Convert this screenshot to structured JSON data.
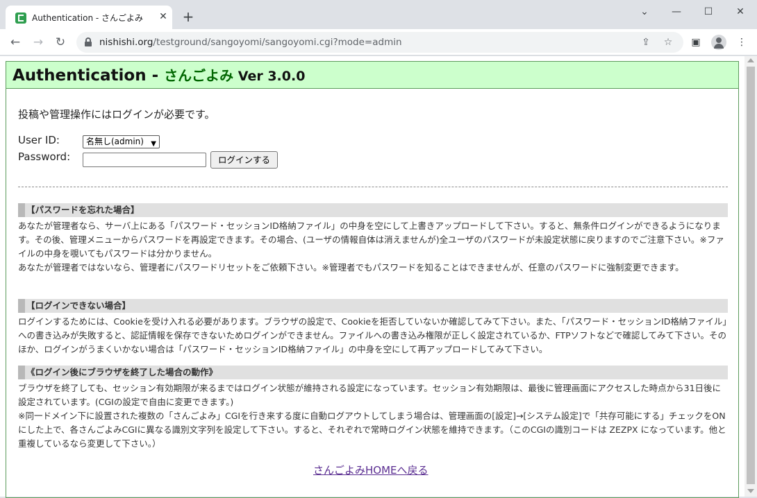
{
  "browser": {
    "tab_title": "Authentication - さんごよみ",
    "url_host": "nishishi.org",
    "url_path": "/testground/sangoyomi/sangoyomi.cgi?mode=admin",
    "close_glyph": "✕",
    "newtab_glyph": "+",
    "back_glyph": "←",
    "forward_glyph": "→",
    "reload_glyph": "↻",
    "minimize_glyph": "—",
    "maximize_glyph": "☐",
    "winclose_glyph": "✕",
    "dropdown_glyph": "⌄",
    "share_glyph": "⇪",
    "star_glyph": "☆",
    "sidepanel_glyph": "▣",
    "menu_glyph": "⋮"
  },
  "page": {
    "title_main": "Authentication - ",
    "title_app": "さんごよみ",
    "title_ver": " Ver 3.0.0",
    "intro": "投稿や管理操作にはログインが必要です。",
    "userid_label": "User ID:",
    "password_label": "Password:",
    "userid_value": "名無し(admin)",
    "login_button": "ログインする",
    "sections": [
      {
        "heading": "【パスワードを忘れた場合】",
        "body": "あなたが管理者なら、サーバ上にある「パスワード・セッションID格納ファイル」の中身を空にして上書きアップロードして下さい。すると、無条件ログインができるようになります。その後、管理メニューからパスワードを再設定できます。その場合、(ユーザの情報自体は消えませんが)全ユーザのパスワードが未設定状態に戻りますのでご注意下さい。※ファイルの中身を覗いてもパスワードは分かりません。",
        "body2": "あなたが管理者ではないなら、管理者にパスワードリセットをご依頼下さい。※管理者でもパスワードを知ることはできませんが、任意のパスワードに強制変更できます。"
      },
      {
        "heading": "【ログインできない場合】",
        "body": "ログインするためには、Cookieを受け入れる必要があります。ブラウザの設定で、Cookieを拒否していないか確認してみて下さい。また、「パスワード・セッションID格納ファイル」への書き込みが失敗すると、認証情報を保存できないためログインができません。ファイルへの書き込み権限が正しく設定されているか、FTPソフトなどで確認してみて下さい。そのほか、ログインがうまくいかない場合は「パスワード・セッションID格納ファイル」の中身を空にして再アップロードしてみて下さい。"
      },
      {
        "heading": "《ログイン後にブラウザを終了した場合の動作》",
        "body": "ブラウザを終了しても、セッション有効期限が来るまではログイン状態が維持される設定になっています。セッション有効期限は、最後に管理画面にアクセスした時点から31日後に設定されています。(CGIの設定で自由に変更できます。)",
        "body2": "※同一ドメイン下に設置された複数の「さんごよみ」CGIを行き来する度に自動ログアウトしてしまう場合は、管理画面の[設定]→[システム設定]で「共存可能にする」チェックをONにした上で、各さんごよみCGIに異なる識別文字列を設定して下さい。すると、それぞれで常時ログイン状態を維持できます。（このCGIの識別コードは ZEZPX になっています。他と重複しているなら変更して下さい。）"
      }
    ],
    "home_link": "さんごよみHOMEへ戻る"
  }
}
